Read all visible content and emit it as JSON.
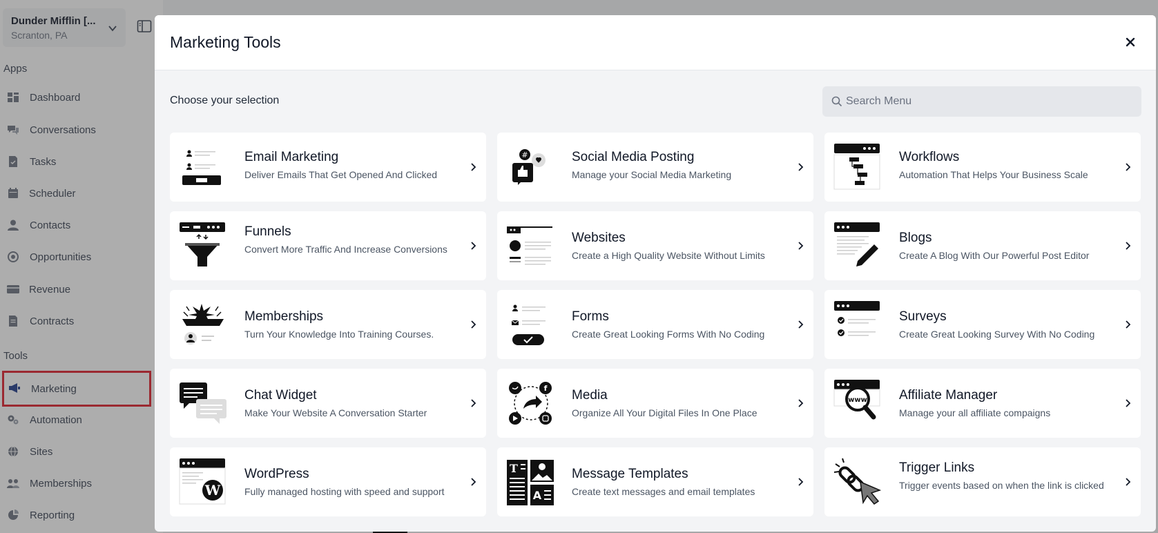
{
  "account": {
    "name": "Dunder Mifflin [...",
    "location": "Scranton, PA"
  },
  "sidebar": {
    "apps_label": "Apps",
    "tools_label": "Tools",
    "apps": [
      {
        "label": "Dashboard",
        "icon": "dashboard-icon"
      },
      {
        "label": "Conversations",
        "icon": "chat-icon"
      },
      {
        "label": "Tasks",
        "icon": "tasks-icon"
      },
      {
        "label": "Scheduler",
        "icon": "calendar-icon"
      },
      {
        "label": "Contacts",
        "icon": "person-icon"
      },
      {
        "label": "Opportunities",
        "icon": "target-icon"
      },
      {
        "label": "Revenue",
        "icon": "card-icon"
      },
      {
        "label": "Contracts",
        "icon": "document-icon"
      }
    ],
    "tools": [
      {
        "label": "Marketing",
        "icon": "megaphone-icon",
        "highlighted": true
      },
      {
        "label": "Automation",
        "icon": "gears-icon"
      },
      {
        "label": "Sites",
        "icon": "globe-icon"
      },
      {
        "label": "Memberships",
        "icon": "people-icon"
      },
      {
        "label": "Reporting",
        "icon": "chart-icon"
      }
    ]
  },
  "modal": {
    "title": "Marketing Tools",
    "subtitle": "Choose your selection",
    "search_placeholder": "Search Menu",
    "cards": [
      {
        "title": "Email Marketing",
        "desc": "Deliver Emails That Get Opened And Clicked",
        "icon": "email-marketing-icon"
      },
      {
        "title": "Social Media Posting",
        "desc": "Manage your Social Media Marketing",
        "icon": "social-media-icon"
      },
      {
        "title": "Workflows",
        "desc": "Automation That Helps Your Business Scale",
        "icon": "workflow-icon"
      },
      {
        "title": "Funnels",
        "desc": "Convert More Traffic And Increase Conversions",
        "icon": "funnel-icon"
      },
      {
        "title": "Websites",
        "desc": "Create a High Quality Website Without Limits",
        "icon": "website-icon"
      },
      {
        "title": "Blogs",
        "desc": "Create A Blog With Our Powerful Post Editor",
        "icon": "blog-icon"
      },
      {
        "title": "Memberships",
        "desc": "Turn Your Knowledge Into Training Courses.",
        "icon": "membership-icon"
      },
      {
        "title": "Forms",
        "desc": "Create Great Looking Forms With No Coding",
        "icon": "form-icon"
      },
      {
        "title": "Surveys",
        "desc": "Create Great Looking Survey With No Coding",
        "icon": "survey-icon"
      },
      {
        "title": "Chat Widget",
        "desc": "Make Your Website A Conversation Starter",
        "icon": "chat-widget-icon"
      },
      {
        "title": "Media",
        "desc": "Organize All Your Digital Files In One Place",
        "icon": "media-icon"
      },
      {
        "title": "Affiliate Manager",
        "desc": "Manage your all affiliate compaigns",
        "icon": "affiliate-icon"
      },
      {
        "title": "WordPress",
        "desc": "Fully managed hosting with speed and support",
        "icon": "wordpress-icon"
      },
      {
        "title": "Message Templates",
        "desc": "Create text messages and email templates",
        "icon": "message-template-icon"
      },
      {
        "title": "Trigger Links",
        "desc": "Trigger events based on when the link is clicked",
        "icon": "trigger-link-icon"
      }
    ]
  }
}
